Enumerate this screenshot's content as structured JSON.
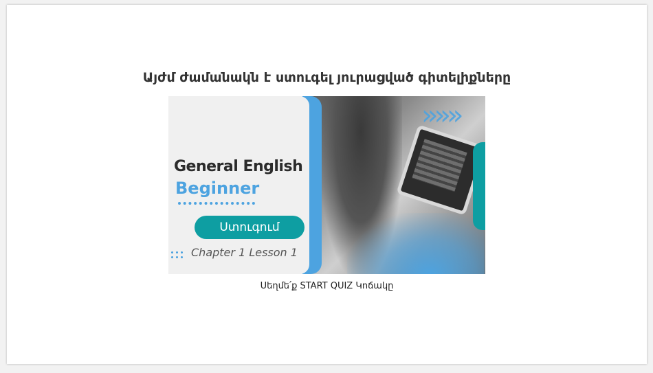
{
  "page": {
    "heading": "Այժմ ժամանակն է ստուգել յուրացված գիտելիքները",
    "instruction": "Սեղմե՛ք START QUIZ Կոճակը"
  },
  "banner": {
    "title_line1": "General English",
    "title_line2": "Beginner",
    "pill_label": "Ստուգում",
    "chapter_text": "Chapter 1 Lesson 1",
    "chevrons": "»»»",
    "colors": {
      "accent_blue": "#4da3e0",
      "teal": "#0e9ea2",
      "panel_bg": "#f0f0f0",
      "title_dark": "#2b2b2b"
    }
  }
}
